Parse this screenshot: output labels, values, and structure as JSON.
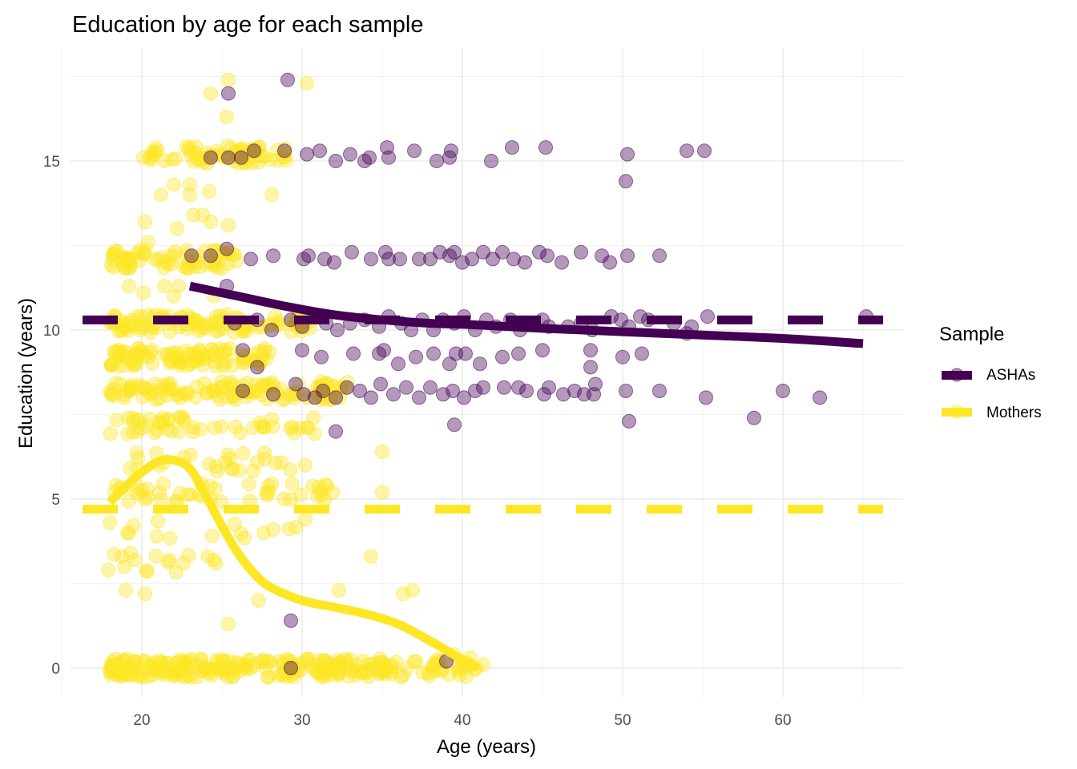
{
  "chart_data": {
    "type": "scatter",
    "title": "Education by age for each sample",
    "xlabel": "Age (years)",
    "ylabel": "Education (years)",
    "xlim": [
      15.5,
      67.5
    ],
    "ylim": [
      -1.7,
      18.5
    ],
    "x_ticks": [
      20,
      30,
      40,
      50,
      60
    ],
    "x_tick_labels": [
      "20",
      "30",
      "40",
      "50",
      "60"
    ],
    "y_ticks": [
      0,
      5,
      10,
      15
    ],
    "y_tick_labels": [
      "0",
      "5",
      "10",
      "15"
    ],
    "grid": true,
    "legend": {
      "title": "Sample",
      "position": "right",
      "entries": [
        {
          "name": "ASHAs",
          "label": "ASHAs",
          "color": "#440154"
        },
        {
          "name": "Mothers",
          "label": "Mothers",
          "color": "#FDE725"
        }
      ]
    },
    "series": [
      {
        "name": "ASHAs",
        "color": "#440154",
        "point_alpha": 0.4,
        "mean_line": 10.3,
        "smooth": {
          "x": [
            23,
            26,
            29,
            32,
            35,
            38,
            41,
            45,
            50,
            55,
            60,
            65
          ],
          "y": [
            11.3,
            11.0,
            10.7,
            10.45,
            10.3,
            10.2,
            10.15,
            10.05,
            9.95,
            9.85,
            9.75,
            9.6
          ]
        },
        "points": [
          [
            29.1,
            17.4
          ],
          [
            25.4,
            17.0
          ],
          [
            24.3,
            15.1
          ],
          [
            25.4,
            15.1
          ],
          [
            26.2,
            15.1
          ],
          [
            27.0,
            15.3
          ],
          [
            28.9,
            15.3
          ],
          [
            30.3,
            15.2
          ],
          [
            31.1,
            15.3
          ],
          [
            32.1,
            15.0
          ],
          [
            33.0,
            15.2
          ],
          [
            33.9,
            15.0
          ],
          [
            34.2,
            15.1
          ],
          [
            35.4,
            15.1
          ],
          [
            35.3,
            15.4
          ],
          [
            37.0,
            15.3
          ],
          [
            38.4,
            15.0
          ],
          [
            39.2,
            15.1
          ],
          [
            39.3,
            15.3
          ],
          [
            41.8,
            15.0
          ],
          [
            43.1,
            15.4
          ],
          [
            45.2,
            15.4
          ],
          [
            50.3,
            15.2
          ],
          [
            50.2,
            14.4
          ],
          [
            54.0,
            15.3
          ],
          [
            55.1,
            15.3
          ],
          [
            23.1,
            12.2
          ],
          [
            24.3,
            12.2
          ],
          [
            25.3,
            12.4
          ],
          [
            26.8,
            12.1
          ],
          [
            28.2,
            12.2
          ],
          [
            30.1,
            12.1
          ],
          [
            30.4,
            12.2
          ],
          [
            31.4,
            12.1
          ],
          [
            32.0,
            12.0
          ],
          [
            33.1,
            12.3
          ],
          [
            34.3,
            12.1
          ],
          [
            35.2,
            12.3
          ],
          [
            35.4,
            12.1
          ],
          [
            36.1,
            12.1
          ],
          [
            37.3,
            12.1
          ],
          [
            38.0,
            12.1
          ],
          [
            38.6,
            12.3
          ],
          [
            39.2,
            12.2
          ],
          [
            39.5,
            12.3
          ],
          [
            40.0,
            12.0
          ],
          [
            40.6,
            12.1
          ],
          [
            41.3,
            12.3
          ],
          [
            41.9,
            12.1
          ],
          [
            42.5,
            12.3
          ],
          [
            43.2,
            12.1
          ],
          [
            43.9,
            12.0
          ],
          [
            44.8,
            12.3
          ],
          [
            45.3,
            12.2
          ],
          [
            46.2,
            12.0
          ],
          [
            47.4,
            12.3
          ],
          [
            48.7,
            12.2
          ],
          [
            49.2,
            12.0
          ],
          [
            50.3,
            12.2
          ],
          [
            52.3,
            12.2
          ],
          [
            25.3,
            11.3
          ],
          [
            25.8,
            10.2
          ],
          [
            27.2,
            10.3
          ],
          [
            28.1,
            10.0
          ],
          [
            29.3,
            10.3
          ],
          [
            30.0,
            10.1
          ],
          [
            31.5,
            10.2
          ],
          [
            32.2,
            10.0
          ],
          [
            33.0,
            10.2
          ],
          [
            33.9,
            10.3
          ],
          [
            34.8,
            10.1
          ],
          [
            35.4,
            10.4
          ],
          [
            36.2,
            10.2
          ],
          [
            36.8,
            10.0
          ],
          [
            37.5,
            10.3
          ],
          [
            38.2,
            10.0
          ],
          [
            38.8,
            10.3
          ],
          [
            39.5,
            10.2
          ],
          [
            40.1,
            10.4
          ],
          [
            40.8,
            10.0
          ],
          [
            41.5,
            10.3
          ],
          [
            42.1,
            10.1
          ],
          [
            43.0,
            10.3
          ],
          [
            43.6,
            10.0
          ],
          [
            44.2,
            10.2
          ],
          [
            45.0,
            10.3
          ],
          [
            45.4,
            10.1
          ],
          [
            46.6,
            10.1
          ],
          [
            47.4,
            10.2
          ],
          [
            48.1,
            10.0
          ],
          [
            49.3,
            10.4
          ],
          [
            49.9,
            10.3
          ],
          [
            50.4,
            10.1
          ],
          [
            51.1,
            10.4
          ],
          [
            51.6,
            10.3
          ],
          [
            53.2,
            10.2
          ],
          [
            54.0,
            9.9
          ],
          [
            54.3,
            10.1
          ],
          [
            55.3,
            10.4
          ],
          [
            65.2,
            10.4
          ],
          [
            26.3,
            9.4
          ],
          [
            30.0,
            9.4
          ],
          [
            31.2,
            9.2
          ],
          [
            33.2,
            9.3
          ],
          [
            34.8,
            9.3
          ],
          [
            35.1,
            9.4
          ],
          [
            36.0,
            9.0
          ],
          [
            37.1,
            9.2
          ],
          [
            38.2,
            9.3
          ],
          [
            39.2,
            9.0
          ],
          [
            39.6,
            9.3
          ],
          [
            40.2,
            9.3
          ],
          [
            41.1,
            9.0
          ],
          [
            42.5,
            9.2
          ],
          [
            43.5,
            9.3
          ],
          [
            45.0,
            9.4
          ],
          [
            48.0,
            9.4
          ],
          [
            48.0,
            8.9
          ],
          [
            50.0,
            9.2
          ],
          [
            51.2,
            9.3
          ],
          [
            27.2,
            8.9
          ],
          [
            26.3,
            8.2
          ],
          [
            28.2,
            8.1
          ],
          [
            29.6,
            8.4
          ],
          [
            30.1,
            8.1
          ],
          [
            30.8,
            8.0
          ],
          [
            31.3,
            8.2
          ],
          [
            32.1,
            8.0
          ],
          [
            32.8,
            8.3
          ],
          [
            33.6,
            8.2
          ],
          [
            34.3,
            8.0
          ],
          [
            34.9,
            8.4
          ],
          [
            35.7,
            8.1
          ],
          [
            36.5,
            8.3
          ],
          [
            37.3,
            8.0
          ],
          [
            38.0,
            8.3
          ],
          [
            38.8,
            8.1
          ],
          [
            39.4,
            8.2
          ],
          [
            40.1,
            8.0
          ],
          [
            40.8,
            8.2
          ],
          [
            41.3,
            8.3
          ],
          [
            42.6,
            8.3
          ],
          [
            43.5,
            8.3
          ],
          [
            44.0,
            8.2
          ],
          [
            45.1,
            8.1
          ],
          [
            45.4,
            8.3
          ],
          [
            46.3,
            8.1
          ],
          [
            47.0,
            8.2
          ],
          [
            47.6,
            8.1
          ],
          [
            48.2,
            8.1
          ],
          [
            48.3,
            8.4
          ],
          [
            50.2,
            8.2
          ],
          [
            52.3,
            8.2
          ],
          [
            55.2,
            8.0
          ],
          [
            60.0,
            8.2
          ],
          [
            62.3,
            8.0
          ],
          [
            58.2,
            7.4
          ],
          [
            50.4,
            7.3
          ],
          [
            39.5,
            7.2
          ],
          [
            32.1,
            7.0
          ],
          [
            29.3,
            1.4
          ],
          [
            29.3,
            0.0
          ],
          [
            39.0,
            0.2
          ]
        ]
      },
      {
        "name": "Mothers",
        "color": "#FDE725",
        "point_alpha": 0.4,
        "mean_line": 4.7,
        "smooth": {
          "x": [
            18,
            19.5,
            21,
            22,
            23,
            24,
            25,
            26,
            27,
            28,
            30,
            32,
            34,
            36,
            38,
            40,
            41
          ],
          "y": [
            4.9,
            5.6,
            6.1,
            6.15,
            5.9,
            5.1,
            4.2,
            3.4,
            2.8,
            2.4,
            2.0,
            1.8,
            1.6,
            1.3,
            0.8,
            0.25,
            0.0
          ]
        },
        "points_summary": "Dense clusters at Education 0, 3, 4, 5, 6, 7, 8, 9, 10, 12, 13, 14, 15 for ages ~18-30, with sparser points to ~41 at Education 0",
        "clusters": [
          {
            "edu": 0,
            "age_min": 18,
            "age_max": 41,
            "count": 260
          },
          {
            "edu": 8.2,
            "age_min": 18,
            "age_max": 33,
            "count": 120
          },
          {
            "edu": 9.2,
            "age_min": 18,
            "age_max": 28,
            "count": 100
          },
          {
            "edu": 10.2,
            "age_min": 18,
            "age_max": 31,
            "count": 110
          },
          {
            "edu": 12.1,
            "age_min": 18,
            "age_max": 26,
            "count": 70
          },
          {
            "edu": 15.2,
            "age_min": 20,
            "age_max": 29,
            "count": 70
          },
          {
            "edu": 7.2,
            "age_min": 18,
            "age_max": 31,
            "count": 50
          },
          {
            "edu": 6.1,
            "age_min": 18,
            "age_max": 30,
            "count": 25
          },
          {
            "edu": 5.2,
            "age_min": 18,
            "age_max": 32,
            "count": 45
          },
          {
            "edu": 4.1,
            "age_min": 18,
            "age_max": 30,
            "count": 12
          },
          {
            "edu": 3.1,
            "age_min": 18,
            "age_max": 25,
            "count": 12
          }
        ],
        "points": [
          [
            25.4,
            17.4
          ],
          [
            24.3,
            17.0
          ],
          [
            30.3,
            17.3
          ],
          [
            25.3,
            16.3
          ],
          [
            21.2,
            14.0
          ],
          [
            22.0,
            14.3
          ],
          [
            23.0,
            14.3
          ],
          [
            23.0,
            14.0
          ],
          [
            24.2,
            14.1
          ],
          [
            28.1,
            14.0
          ],
          [
            20.2,
            13.2
          ],
          [
            23.2,
            13.4
          ],
          [
            23.8,
            13.4
          ],
          [
            24.3,
            13.2
          ],
          [
            25.4,
            13.1
          ],
          [
            20.4,
            12.6
          ],
          [
            22.2,
            13.0
          ],
          [
            19.2,
            11.3
          ],
          [
            20.1,
            11.1
          ],
          [
            21.4,
            11.3
          ],
          [
            22.3,
            11.3
          ],
          [
            22.0,
            11.0
          ],
          [
            24.5,
            11.0
          ],
          [
            35.0,
            6.4
          ],
          [
            30.2,
            6.0
          ],
          [
            27.2,
            6.1
          ],
          [
            35.0,
            5.2
          ],
          [
            31.2,
            5.1
          ],
          [
            31.9,
            5.2
          ],
          [
            30.2,
            4.4
          ],
          [
            28.2,
            4.1
          ],
          [
            19.2,
            4.0
          ],
          [
            18.0,
            4.3
          ],
          [
            34.3,
            3.3
          ],
          [
            19.3,
            3.4
          ],
          [
            18.9,
            3.0
          ],
          [
            17.9,
            2.9
          ],
          [
            22.6,
            3.1
          ],
          [
            24.5,
            3.2
          ],
          [
            36.3,
            2.2
          ],
          [
            36.9,
            2.3
          ],
          [
            32.3,
            2.3
          ],
          [
            27.3,
            2.0
          ],
          [
            19.0,
            2.3
          ],
          [
            20.2,
            2.2
          ],
          [
            25.4,
            1.3
          ],
          [
            37.0,
            0.2
          ],
          [
            39.5,
            0.4
          ],
          [
            40.5,
            0.3
          ],
          [
            41.3,
            0.1
          ],
          [
            38.3,
            0.1
          ]
        ]
      }
    ]
  }
}
